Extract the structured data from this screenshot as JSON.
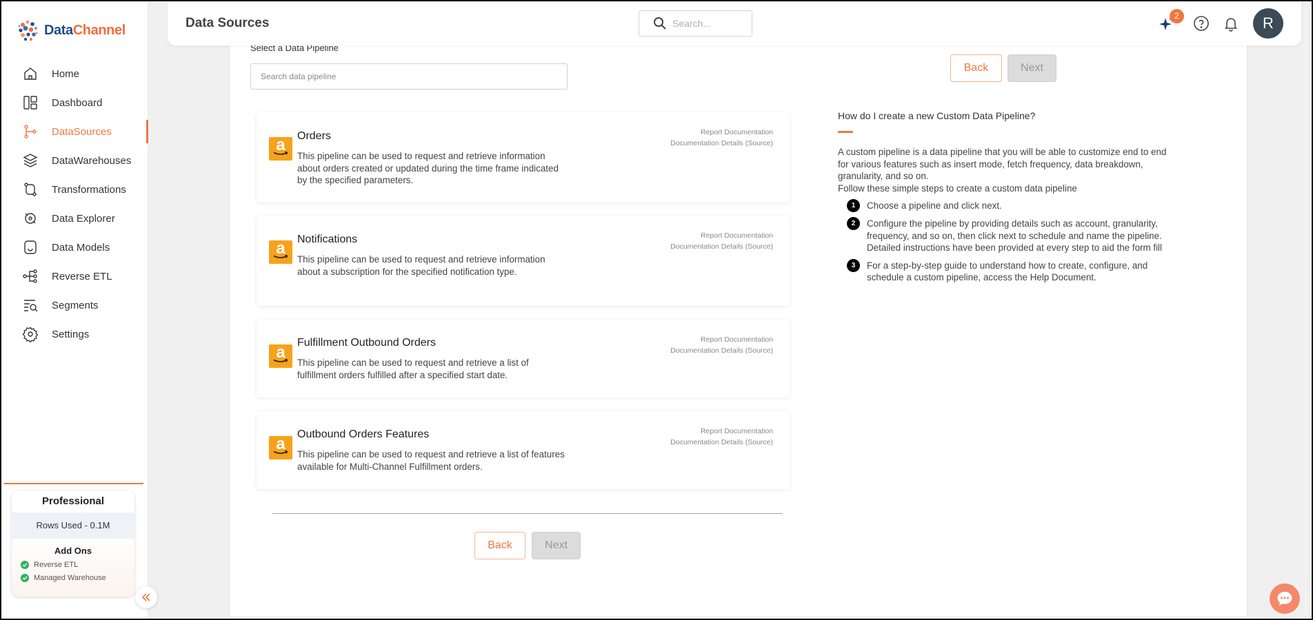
{
  "app": {
    "logo_part1": "Data",
    "logo_part2": "Channel"
  },
  "sidebar": {
    "items": [
      {
        "label": "Home",
        "icon": "home-icon",
        "active": false
      },
      {
        "label": "Dashboard",
        "icon": "dashboard-icon",
        "active": false
      },
      {
        "label": "DataSources",
        "icon": "datasources-icon",
        "active": true
      },
      {
        "label": "DataWarehouses",
        "icon": "datawarehouses-icon",
        "active": false
      },
      {
        "label": "Transformations",
        "icon": "transformations-icon",
        "active": false
      },
      {
        "label": "Data Explorer",
        "icon": "data-explorer-icon",
        "active": false
      },
      {
        "label": "Data Models",
        "icon": "data-models-icon",
        "active": false
      },
      {
        "label": "Reverse ETL",
        "icon": "reverse-etl-icon",
        "active": false
      },
      {
        "label": "Segments",
        "icon": "segments-icon",
        "active": false
      },
      {
        "label": "Settings",
        "icon": "settings-icon",
        "active": false
      }
    ],
    "plan": {
      "title": "Professional",
      "rows_used": "Rows Used - 0.1M",
      "addons_title": "Add Ons",
      "addons": [
        "Reverse ETL",
        "Managed Warehouse"
      ]
    }
  },
  "header": {
    "title": "Data Sources",
    "search_placeholder": "Search...",
    "notification_badge": "2",
    "avatar_initial": "R"
  },
  "main": {
    "select_label": "Select a Data Pipeline",
    "search_placeholder": "Search data pipeline",
    "back_label": "Back",
    "next_label": "Next",
    "pipelines": [
      {
        "title": "Orders",
        "description": "This pipeline can be used to request and retrieve information about orders created or updated during the time frame indicated by the specified parameters.",
        "link1": "Report Documentation",
        "link2": "Documentation Details (Source)"
      },
      {
        "title": "Notifications",
        "description": "This pipeline can be used to request and retrieve information about a subscription for the specified notification type.",
        "link1": "Report Documentation",
        "link2": "Documentation Details (Source)"
      },
      {
        "title": "Fulfillment Outbound Orders",
        "description": "This pipeline can be used to request and retrieve a list of fulfillment orders fulfilled after a specified start date.",
        "link1": "Report Documentation",
        "link2": "Documentation Details (Source)"
      },
      {
        "title": "Outbound Orders Features",
        "description": "This pipeline can be used to request and retrieve a list of features available for Multi-Channel Fulfillment orders.",
        "link1": "Report Documentation",
        "link2": "Documentation Details (Source)"
      }
    ]
  },
  "help": {
    "title": "How do I create a new Custom Data Pipeline?",
    "intro": "A custom pipeline is a data pipeline that you will be able to customize end to end for various features such as insert mode, fetch frequency, data breakdown, granularity, and so on.",
    "follow": "Follow these simple steps to create a custom data pipeline",
    "steps": [
      {
        "num": "1",
        "text": "Choose a pipeline and click next."
      },
      {
        "num": "2",
        "text": "Configure the pipeline by providing details such as account, granularity, frequency, and so on, then click next to schedule and name the pipeline. Detailed instructions have been provided at every step to aid the form fill"
      },
      {
        "num": "3",
        "text": "For a step-by-step guide to understand how to create, configure, and schedule a custom pipeline, access the Help Document."
      }
    ]
  },
  "colors": {
    "accent": "#f0773f",
    "amazon": "#f7a21b",
    "success": "#2fb25a"
  }
}
